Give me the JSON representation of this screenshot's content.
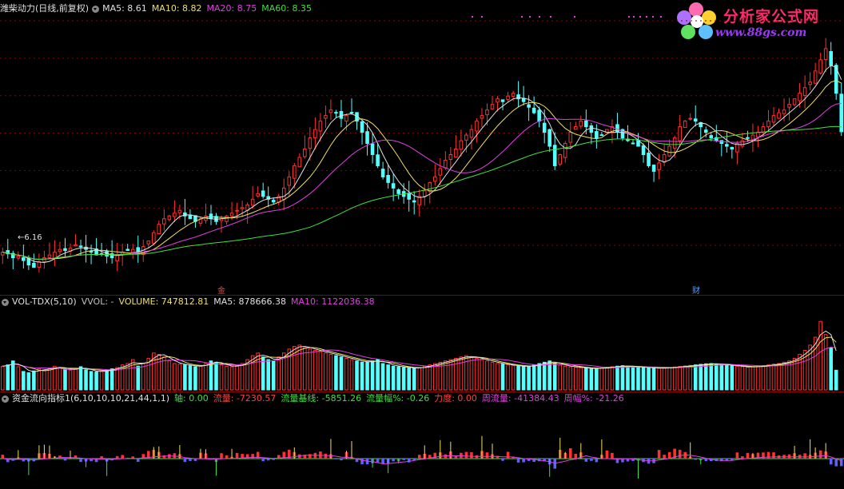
{
  "main": {
    "title": "潍柴动力(日线,前复权)",
    "ma": [
      {
        "label": "MA5: 8.61",
        "color": "#e0e0e0"
      },
      {
        "label": "MA10: 8.82",
        "color": "#f0e060"
      },
      {
        "label": "MA20: 8.75",
        "color": "#e040e0"
      },
      {
        "label": "MA60: 8.35",
        "color": "#40e040"
      }
    ],
    "low_label": "6.16",
    "markers": [
      "金",
      "财"
    ]
  },
  "vol": {
    "title": "VOL-TDX(5,10)",
    "items": [
      {
        "label": "VVOL: -",
        "color": "#c0c0c0"
      },
      {
        "label": "VOLUME: 747812.81",
        "color": "#f0e060"
      },
      {
        "label": "MA5: 878666.38",
        "color": "#e0e0e0"
      },
      {
        "label": "MA10: 1122036.38",
        "color": "#e040e0"
      }
    ]
  },
  "flow": {
    "title": "资金流向指标1(6,10,10,10,21,44,1,1)",
    "items": [
      {
        "label": "轴: 0.00",
        "color": "#40e040"
      },
      {
        "label": "流量: -7230.57",
        "color": "#ff4040"
      },
      {
        "label": "流量基线: -5851.26",
        "color": "#40e040"
      },
      {
        "label": "流量幅%: -0.26",
        "color": "#40e040"
      },
      {
        "label": "力度: 0.00",
        "color": "#ff4040"
      },
      {
        "label": "周流量: -41384.43",
        "color": "#e040e0"
      },
      {
        "label": "周幅%: -21.26",
        "color": "#e040e0"
      }
    ]
  },
  "logo": {
    "brand": "分析家公式网",
    "url": "www.88gs.com"
  },
  "colors": {
    "up": "#ff3030",
    "down": "#54ffff",
    "ma5": "#e0e0e0",
    "ma10": "#f0e060",
    "ma20": "#e040e0",
    "ma60": "#40e040",
    "grid": "#8b0000"
  },
  "chart_data": {
    "type": "candlestick",
    "price_ylim": [
      5.9,
      10.6
    ],
    "closes": [
      6.45,
      6.42,
      6.35,
      6.38,
      6.3,
      6.22,
      6.18,
      6.28,
      6.35,
      6.4,
      6.45,
      6.5,
      6.48,
      6.52,
      6.58,
      6.55,
      6.5,
      6.45,
      6.4,
      6.42,
      6.38,
      6.35,
      6.4,
      6.45,
      6.48,
      6.5,
      6.45,
      6.55,
      6.65,
      6.8,
      6.95,
      7.05,
      7.1,
      7.15,
      7.2,
      7.1,
      7.05,
      7.0,
      7.05,
      7.1,
      7.05,
      7.0,
      7.05,
      7.1,
      7.15,
      7.2,
      7.25,
      7.3,
      7.4,
      7.5,
      7.45,
      7.4,
      7.35,
      7.45,
      7.6,
      7.8,
      8.0,
      8.15,
      8.3,
      8.5,
      8.65,
      8.8,
      8.9,
      9.0,
      8.95,
      8.85,
      8.9,
      8.95,
      8.8,
      8.6,
      8.4,
      8.2,
      8.0,
      7.8,
      7.7,
      7.6,
      7.5,
      7.45,
      7.4,
      7.35,
      7.45,
      7.55,
      7.7,
      7.8,
      7.95,
      8.1,
      8.2,
      8.3,
      8.45,
      8.55,
      8.65,
      8.8,
      8.9,
      9.0,
      9.1,
      9.2,
      9.15,
      9.25,
      9.3,
      9.2,
      9.15,
      9.05,
      8.95,
      8.8,
      8.6,
      8.35,
      8.0,
      8.2,
      8.4,
      8.6,
      8.7,
      8.8,
      8.7,
      8.6,
      8.5,
      8.55,
      8.65,
      8.7,
      8.6,
      8.5,
      8.45,
      8.4,
      8.35,
      8.2,
      8.0,
      7.9,
      8.05,
      8.2,
      8.35,
      8.5,
      8.7,
      8.8,
      8.85,
      8.8,
      8.7,
      8.6,
      8.5,
      8.45,
      8.4,
      8.35,
      8.3,
      8.4,
      8.45,
      8.5,
      8.55,
      8.6,
      8.7,
      8.8,
      8.9,
      8.95,
      9.0,
      9.1,
      9.2,
      9.3,
      9.4,
      9.5,
      9.7,
      9.9,
      10.1,
      9.8,
      9.3,
      8.61
    ],
    "volume_scale_max": 3000000,
    "volumes": [
      900000,
      950000,
      1100000,
      880000,
      700000,
      650000,
      720000,
      800000,
      760000,
      820000,
      900000,
      850000,
      780000,
      750000,
      820000,
      880000,
      760000,
      700000,
      680000,
      720000,
      760000,
      800000,
      850000,
      950000,
      1000000,
      1150000,
      900000,
      1000000,
      1200000,
      1400000,
      1350000,
      1250000,
      1100000,
      1000000,
      980000,
      950000,
      920000,
      880000,
      900000,
      1000000,
      1100000,
      1050000,
      950000,
      900000,
      880000,
      920000,
      1000000,
      1150000,
      1300000,
      1400000,
      1250000,
      1150000,
      1100000,
      1250000,
      1400000,
      1550000,
      1650000,
      1700000,
      1600000,
      1550000,
      1500000,
      1450000,
      1400000,
      1350000,
      1300000,
      1250000,
      1200000,
      1150000,
      1100000,
      1050000,
      1050000,
      1100000,
      1150000,
      1000000,
      950000,
      900000,
      880000,
      850000,
      830000,
      820000,
      850000,
      900000,
      950000,
      1000000,
      1050000,
      1100000,
      1150000,
      1200000,
      1250000,
      1300000,
      1250000,
      1200000,
      1150000,
      1100000,
      1050000,
      1000000,
      980000,
      950000,
      920000,
      900000,
      880000,
      900000,
      950000,
      1000000,
      1050000,
      1100000,
      1000000,
      950000,
      900000,
      880000,
      860000,
      840000,
      820000,
      800000,
      820000,
      840000,
      860000,
      880000,
      900000,
      920000,
      900000,
      880000,
      860000,
      850000,
      840000,
      830000,
      820000,
      830000,
      850000,
      870000,
      890000,
      910000,
      930000,
      950000,
      970000,
      990000,
      1000000,
      980000,
      960000,
      940000,
      920000,
      900000,
      880000,
      860000,
      880000,
      900000,
      920000,
      950000,
      980000,
      1000000,
      1050000,
      1100000,
      1200000,
      1350000,
      1500000,
      1700000,
      2000000,
      2600000,
      2100000,
      1600000,
      747812.81
    ],
    "flow_ylim": [
      -8000,
      8000
    ],
    "series": [
      {
        "name": "MA5",
        "values": []
      },
      {
        "name": "MA10",
        "values": []
      },
      {
        "name": "MA20",
        "values": []
      },
      {
        "name": "MA60",
        "values": []
      }
    ]
  }
}
